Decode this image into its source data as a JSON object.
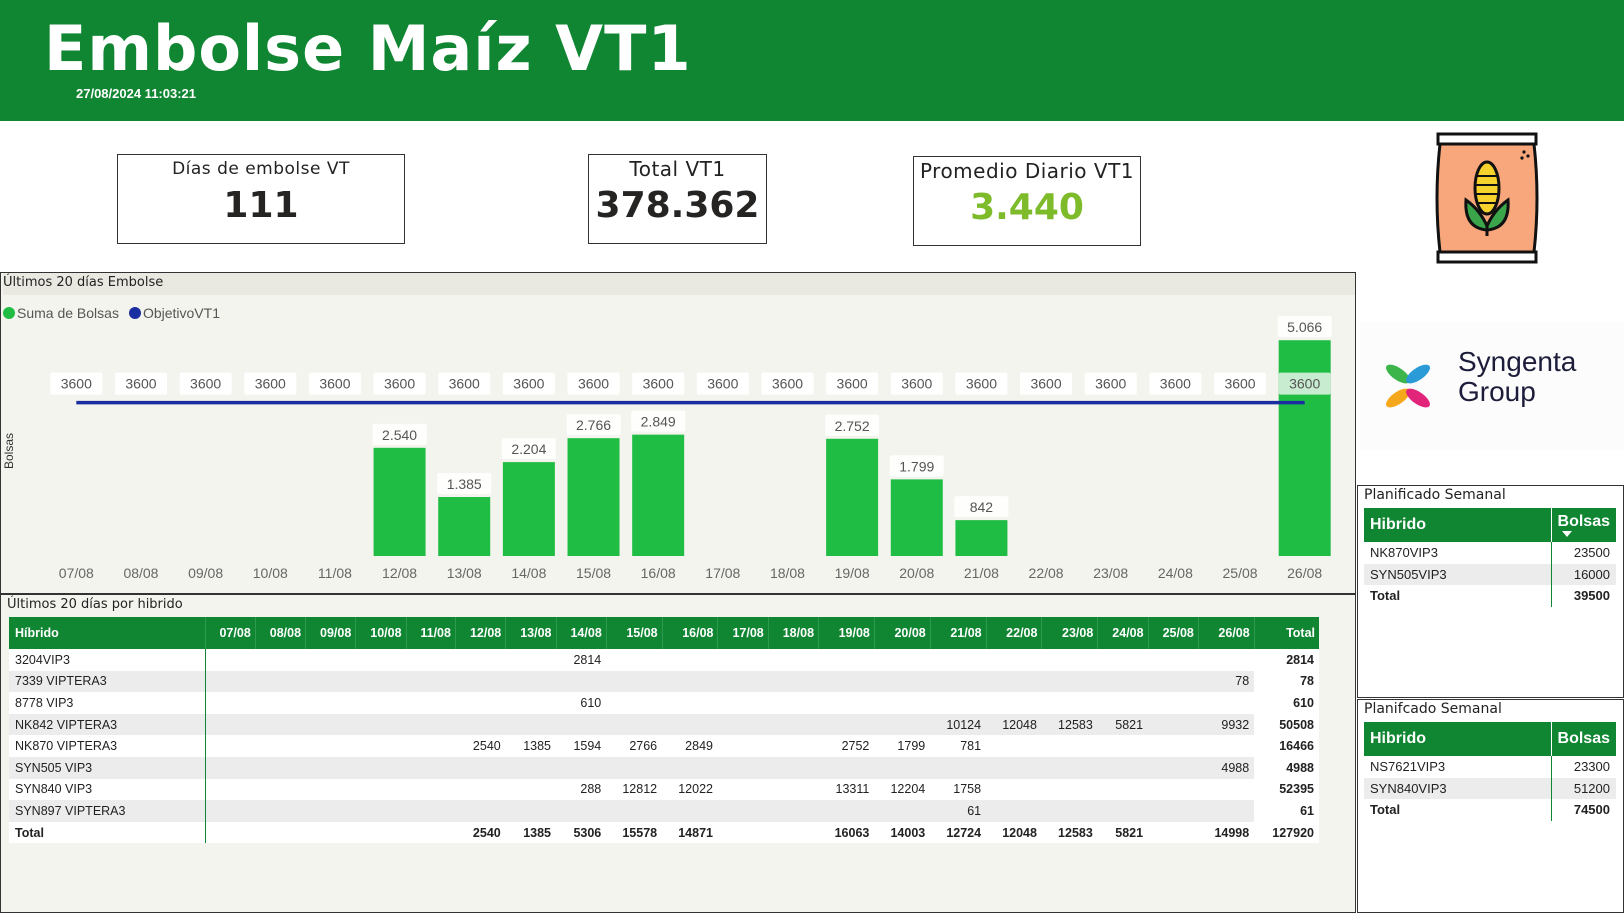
{
  "header": {
    "title": "Embolse Maíz VT1",
    "timestamp": "27/08/2024 11:03:21",
    "background_color": "#108633"
  },
  "kpis": [
    {
      "label": "Días de embolse VT",
      "value": "111",
      "color": "#252423"
    },
    {
      "label": "Total VT1",
      "value": "378.362",
      "color": "#252423"
    },
    {
      "label": "Promedio Diario VT1",
      "value": "3.440",
      "color": "#7dbb2a"
    }
  ],
  "bag_icon": "corn-bag-icon",
  "logo": {
    "line1": "Syngenta",
    "line2": "Group"
  },
  "chart_panel": {
    "title": "Últimos 20 días Embolse",
    "ylabel": "Bolsas"
  },
  "chart_data": {
    "type": "bar",
    "categories": [
      "07/08",
      "08/08",
      "09/08",
      "10/08",
      "11/08",
      "12/08",
      "13/08",
      "14/08",
      "15/08",
      "16/08",
      "17/08",
      "18/08",
      "19/08",
      "20/08",
      "21/08",
      "22/08",
      "23/08",
      "24/08",
      "25/08",
      "26/08"
    ],
    "series": [
      {
        "name": "Suma de Bolsas",
        "type": "bar",
        "color": "#1fbd43",
        "values": [
          null,
          null,
          null,
          null,
          null,
          2540,
          1385,
          2204,
          2766,
          2849,
          null,
          null,
          2752,
          1799,
          842,
          null,
          null,
          null,
          null,
          5066
        ],
        "labels": [
          "",
          "",
          "",
          "",
          "",
          "2.540",
          "1.385",
          "2.204",
          "2.766",
          "2.849",
          "",
          "",
          "2.752",
          "1.799",
          "842",
          "",
          "",
          "",
          "",
          "5.066"
        ]
      },
      {
        "name": "ObjetivoVT1",
        "type": "line",
        "color": "#1a2ea1",
        "values": [
          3600,
          3600,
          3600,
          3600,
          3600,
          3600,
          3600,
          3600,
          3600,
          3600,
          3600,
          3600,
          3600,
          3600,
          3600,
          3600,
          3600,
          3600,
          3600,
          3600
        ],
        "labels": [
          "3600",
          "3600",
          "3600",
          "3600",
          "3600",
          "3600",
          "3600",
          "3600",
          "3600",
          "3600",
          "3600",
          "3600",
          "3600",
          "3600",
          "3600",
          "3600",
          "3600",
          "3600",
          "3600",
          "3600"
        ]
      }
    ],
    "ylabel": "Bolsas",
    "ylim": [
      0,
      5400
    ],
    "grid": false,
    "legend_position": "top-left"
  },
  "matrix": {
    "title": "Últimos 20 días por hibrido",
    "columns": [
      "Híbrido",
      "07/08",
      "08/08",
      "09/08",
      "10/08",
      "11/08",
      "12/08",
      "13/08",
      "14/08",
      "15/08",
      "16/08",
      "17/08",
      "18/08",
      "19/08",
      "20/08",
      "21/08",
      "22/08",
      "23/08",
      "24/08",
      "25/08",
      "26/08",
      "Total"
    ],
    "rows": [
      [
        "3204VIP3",
        "",
        "",
        "",
        "",
        "",
        "",
        "",
        "2814",
        "",
        "",
        "",
        "",
        "",
        "",
        "",
        "",
        "",
        "",
        "",
        "",
        "2814"
      ],
      [
        "7339 VIPTERA3",
        "",
        "",
        "",
        "",
        "",
        "",
        "",
        "",
        "",
        "",
        "",
        "",
        "",
        "",
        "",
        "",
        "",
        "",
        "",
        "78",
        "78"
      ],
      [
        "8778 VIP3",
        "",
        "",
        "",
        "",
        "",
        "",
        "",
        "610",
        "",
        "",
        "",
        "",
        "",
        "",
        "",
        "",
        "",
        "",
        "",
        "",
        "610"
      ],
      [
        "NK842 VIPTERA3",
        "",
        "",
        "",
        "",
        "",
        "",
        "",
        "",
        "",
        "",
        "",
        "",
        "",
        "",
        "10124",
        "12048",
        "12583",
        "5821",
        "",
        "9932",
        "50508"
      ],
      [
        "NK870 VIPTERA3",
        "",
        "",
        "",
        "",
        "",
        "2540",
        "1385",
        "1594",
        "2766",
        "2849",
        "",
        "",
        "2752",
        "1799",
        "781",
        "",
        "",
        "",
        "",
        "",
        "16466"
      ],
      [
        "SYN505 VIP3",
        "",
        "",
        "",
        "",
        "",
        "",
        "",
        "",
        "",
        "",
        "",
        "",
        "",
        "",
        "",
        "",
        "",
        "",
        "",
        "4988",
        "4988"
      ],
      [
        "SYN840 VIP3",
        "",
        "",
        "",
        "",
        "",
        "",
        "",
        "288",
        "12812",
        "12022",
        "",
        "",
        "13311",
        "12204",
        "1758",
        "",
        "",
        "",
        "",
        "",
        "52395"
      ],
      [
        "SYN897 VIPTERA3",
        "",
        "",
        "",
        "",
        "",
        "",
        "",
        "",
        "",
        "",
        "",
        "",
        "",
        "",
        "61",
        "",
        "",
        "",
        "",
        "",
        "61"
      ]
    ],
    "total_row": [
      "Total",
      "",
      "",
      "",
      "",
      "",
      "2540",
      "1385",
      "5306",
      "15578",
      "14871",
      "",
      "",
      "16063",
      "14003",
      "12724",
      "12048",
      "12583",
      "5821",
      "",
      "14998",
      "127920"
    ]
  },
  "plan_semanal": {
    "title": "Planificado Semanal",
    "headers": [
      "Hibrido",
      "Bolsas"
    ],
    "rows": [
      [
        "NK870VIP3",
        "23500"
      ],
      [
        "SYN505VIP3",
        "16000"
      ]
    ],
    "total": [
      "Total",
      "39500"
    ]
  },
  "plan_semanal_2": {
    "title": "Planifcado Semanal",
    "headers": [
      "Hibrido",
      "Bolsas"
    ],
    "rows": [
      [
        "NS7621VIP3",
        "23300"
      ],
      [
        "SYN840VIP3",
        "51200"
      ]
    ],
    "total": [
      "Total",
      "74500"
    ]
  }
}
